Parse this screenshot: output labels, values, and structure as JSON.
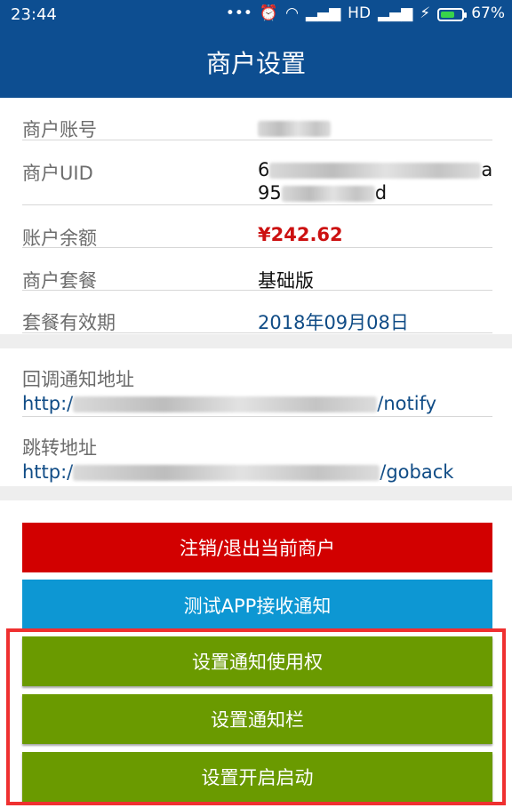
{
  "status_bar": {
    "time": "23:44",
    "network": "HD",
    "battery": "67%",
    "battery_fraction": 0.67
  },
  "header": {
    "title": "商户设置"
  },
  "info_rows": [
    {
      "label": "商户账号"
    },
    {
      "label": "商户UID",
      "value_line1_prefix": "6",
      "value_line1_suffix": "a",
      "value_line2_prefix": "95",
      "value_line2_suffix": "d"
    },
    {
      "label": "账户余额",
      "value": "¥242.62"
    },
    {
      "label": "商户套餐",
      "value": "基础版"
    },
    {
      "label": "套餐有效期",
      "value": "2018年09月08日"
    }
  ],
  "callback": {
    "label": "回调通知地址",
    "prefix": "http:/",
    "suffix": "/notify"
  },
  "redirect": {
    "label": "跳转地址",
    "prefix": "http:/",
    "suffix": "/goback"
  },
  "buttons": {
    "logout": "注销/退出当前商户",
    "test_notify": "测试APP接收通知",
    "notify_permission": "设置通知使用权",
    "notification_bar": "设置通知栏",
    "autostart": "设置开启启动"
  },
  "colors": {
    "header_bg": "#0d4e91",
    "logout_bg": "#d20000",
    "test_bg": "#0d97d3",
    "settings_bg": "#6a9a00",
    "highlight": "#ef3030",
    "amount": "#cc1111"
  }
}
